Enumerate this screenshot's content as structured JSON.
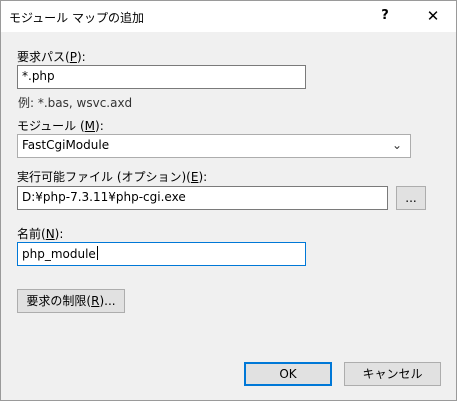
{
  "window": {
    "title": "モジュール マップの追加"
  },
  "titlebar": {
    "help_label": "?",
    "close_icon": "close-icon"
  },
  "request_path": {
    "label_prefix": "要求パス(",
    "label_key": "P",
    "label_suffix": "):",
    "value": "*.php",
    "example": "例: *.bas, wsvc.axd"
  },
  "module": {
    "label_prefix": "モジュール (",
    "label_key": "M",
    "label_suffix": "):",
    "selected": "FastCgiModule"
  },
  "executable": {
    "label_prefix": "実行可能ファイル (オプション)(",
    "label_key": "E",
    "label_suffix": "):",
    "value": "D:¥php-7.3.11¥php-cgi.exe",
    "browse_label": "..."
  },
  "name": {
    "label_prefix": "名前(",
    "label_key": "N",
    "label_suffix": "):",
    "value": "php_module"
  },
  "restrictions": {
    "label_prefix": "要求の制限(",
    "label_key": "R",
    "label_suffix": ")..."
  },
  "footer": {
    "ok_label": "OK",
    "cancel_label": "キャンセル"
  }
}
